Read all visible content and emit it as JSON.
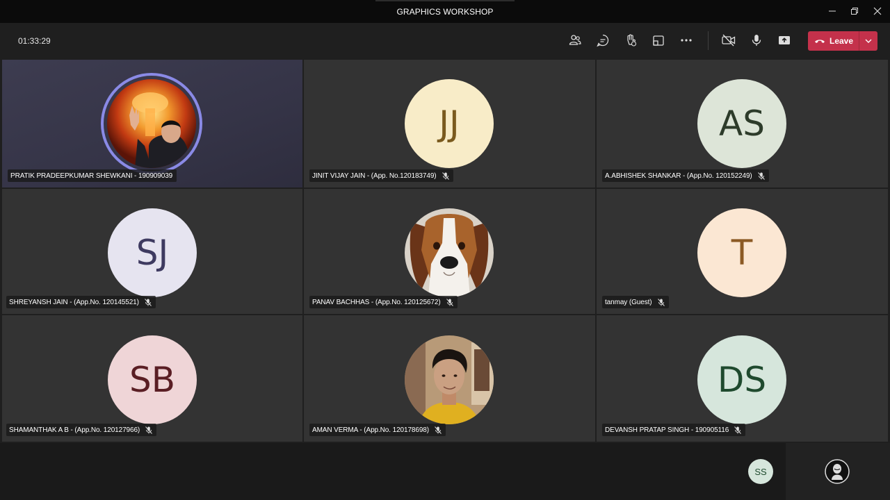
{
  "window": {
    "title": "GRAPHICS WORKSHOP"
  },
  "toolbar": {
    "timer": "01:33:29",
    "leave_label": "Leave",
    "icons": [
      "people-icon",
      "chat-icon",
      "raise-hand-icon",
      "share-tray-icon",
      "more-icon",
      "camera-off-icon",
      "mic-icon",
      "share-screen-icon"
    ]
  },
  "participants": [
    {
      "name": "PRATIK PRADEEPKUMAR SHEWKANI - 190909039",
      "initials": "",
      "avatar": "photo",
      "speaking": true
    },
    {
      "name": "JINIT VIJAY JAIN - (App. No.120183749)",
      "initials": "JJ",
      "bg": "#f8ecc8",
      "fg": "#7a5a1e",
      "muted": true
    },
    {
      "name": "A.ABHISHEK SHANKAR - (App.No. 120152249)",
      "initials": "AS",
      "bg": "#dde5d8",
      "fg": "#2d3b2a",
      "muted": true
    },
    {
      "name": "SHREYANSH JAIN - (App.No. 120145521)",
      "initials": "SJ",
      "bg": "#e6e4f0",
      "fg": "#3e3a60",
      "muted": true
    },
    {
      "name": "PANAV BACHHAS - (App.No. 120125672)",
      "initials": "",
      "avatar": "dog-photo",
      "muted": true
    },
    {
      "name": "tanmay (Guest)",
      "initials": "T",
      "bg": "#fbe7d3",
      "fg": "#8b5a24",
      "muted": true
    },
    {
      "name": "SHAMANTHAK A B - (App.No. 120127966)",
      "initials": "SB",
      "bg": "#efd5d7",
      "fg": "#5a1e24",
      "muted": true
    },
    {
      "name": "AMAN VERMA - (App.No. 120178698)",
      "initials": "",
      "avatar": "photo",
      "muted": true
    },
    {
      "name": "DEVANSH PRATAP SINGH - 190905116",
      "initials": "DS",
      "bg": "#d6e6dc",
      "fg": "#1f4a2e",
      "muted": true
    }
  ],
  "bottom": {
    "overflow_initials": "SS",
    "overflow_bg": "#d6e6dc",
    "overflow_fg": "#1f4a2e"
  }
}
